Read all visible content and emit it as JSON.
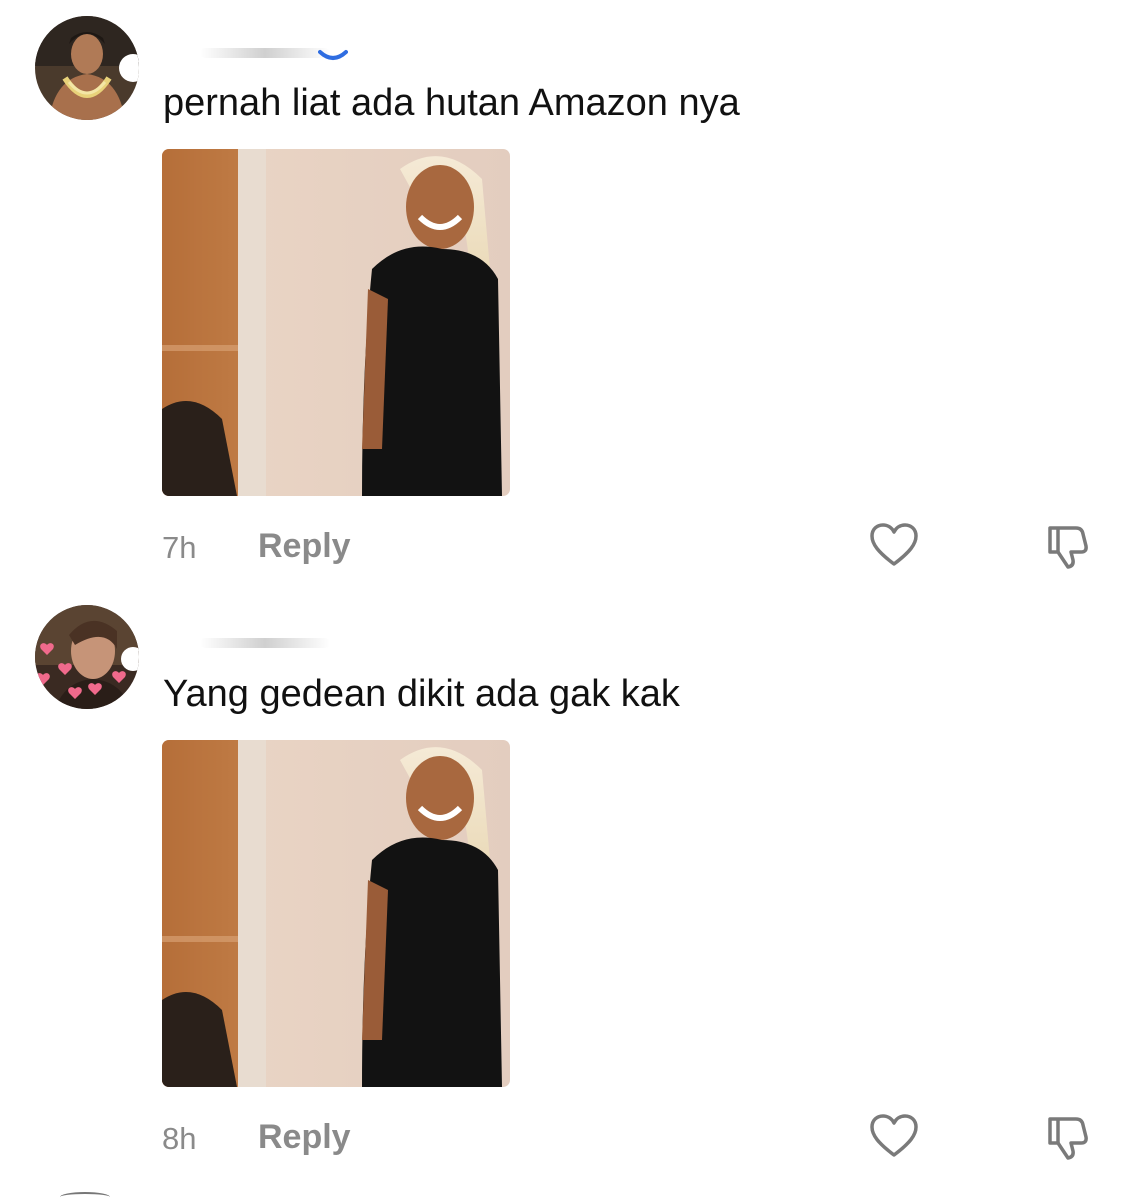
{
  "comments": [
    {
      "text": "pernah liat ada hutan Amazon nya",
      "time": "7h",
      "reply_label": "Reply"
    },
    {
      "text": "Yang gedean dikit ada gak kak",
      "time": "8h",
      "reply_label": "Reply"
    }
  ],
  "icons": {
    "like": "heart-outline-icon",
    "dislike": "thumbs-down-icon"
  },
  "colors": {
    "text": "#111111",
    "meta": "#8a8a8a",
    "verified": "#2f6de1"
  }
}
